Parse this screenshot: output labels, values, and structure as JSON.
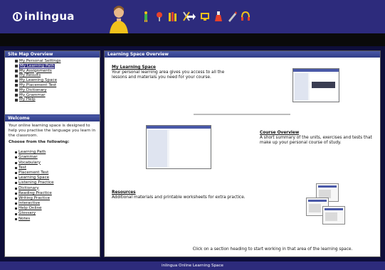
{
  "header": {
    "logo_text": "inlingua",
    "toolbar_icons": [
      "figure-icon",
      "pin-icon",
      "books-icon",
      "tools-icon",
      "arrow-icon",
      "screen-icon",
      "flask-icon",
      "pencil-icon",
      "headset-icon"
    ]
  },
  "sidebar": {
    "tree_title": "Site Map Overview",
    "tree_items": [
      "My Personal Settings",
      "My Learning Path",
      "My Assignments",
      "My Results",
      "My Learning Space",
      "My Placement Test",
      "My Dictionary",
      "My Grammar",
      "My Help"
    ],
    "tree_selected_index": 1,
    "intro_title": "Welcome",
    "intro_text": "Your online learning space is designed to help you practise the language you learn in the classroom.",
    "intro_text_2": "Choose from the following:",
    "links": [
      "Learning Path",
      "Grammar",
      "Vocabulary",
      "Test",
      "Placement Test",
      "Learning Space",
      "Listening Practice",
      "Dictionary",
      "Reading Practice",
      "Writing Practice",
      "Interactive",
      "Help Online",
      "Glossary",
      "Notes"
    ]
  },
  "content": {
    "title": "Learning Space Overview",
    "block1_title": "My Learning Space",
    "block1_text": "Your personal learning area gives you access to all the lessons and materials you need for your course.",
    "block2_title": "Course Overview",
    "block2_text": "A short summary of the units, exercises and tests that make up your personal course of study.",
    "block3_title": "Resources",
    "block3_text": "Additional materials and printable worksheets for extra practice.",
    "bottom_text": "Click on a section heading to start working in that area of the learning space."
  },
  "footer": {
    "text": "inlingua Online Learning Space"
  },
  "colors": {
    "brand_navy": "#2d2b7c",
    "panel_header": "#4a59a8",
    "frame": "#0e0e3a"
  }
}
